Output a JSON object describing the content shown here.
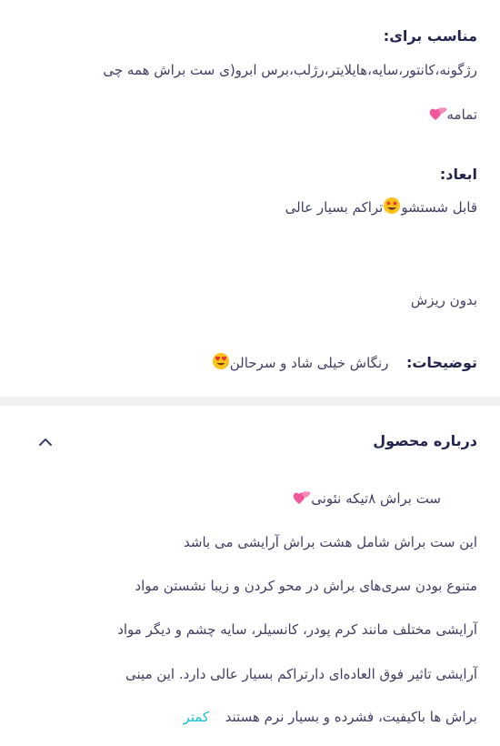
{
  "specs": {
    "suitable_label": "مناسب برای:",
    "suitable_line1": "رژگونه،کانتور،سایه،هایلایتر،رژلب،برس ابرو(ی ست براش همه چی",
    "suitable_line2": "تمامه",
    "features_label": "ابعاد:",
    "features_line1a": "قابل شستشو",
    "features_line1b": "تراکم بسیار عالی",
    "features_line2": "بدون ریزش",
    "description_label": "توضیحات:",
    "description_value": "رنگاش خیلی شاد و سرحالن"
  },
  "about": {
    "title": "درباره محصول",
    "collapse_icon": "chevron-up-icon",
    "line0": "ست براش ۸تیکه نئونی",
    "line1": "این ست براش شامل هشت براش آرایشی می باشد",
    "line2": "متنوع بودن سری‌های براش در محو کردن و زیبا نشستن مواد",
    "line3": "آرایشی مختلف مانند کرم پودر، کانسیلر، سایه چشم و دیگر مواد",
    "line4": "آرایشی تاثیر فوق العاده‌ای دارتراکم بسیار عالی دارد. این مینی",
    "line5": "براش ها باکیفیت، فشرده و بسیار نرم هستند",
    "less_link": "کمتر"
  },
  "colors": {
    "text": "#3f4064",
    "heading": "#23254e",
    "link": "#19bfd3",
    "divider": "#f0f0f1"
  }
}
